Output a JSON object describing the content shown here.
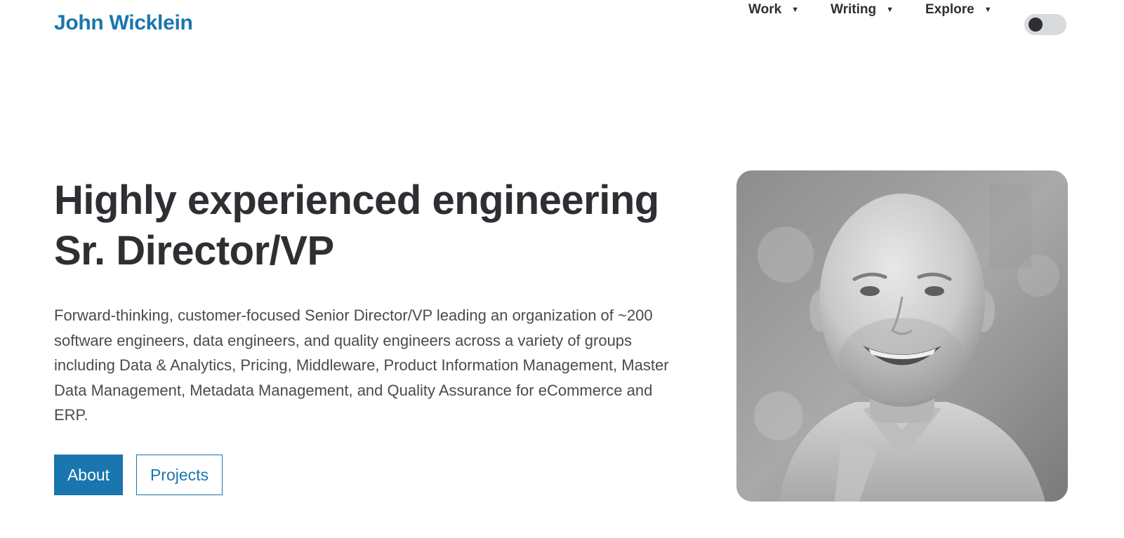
{
  "header": {
    "site_title": "John Wicklein",
    "nav": [
      {
        "label": "Work",
        "icon": "caret-down-icon"
      },
      {
        "label": "Writing",
        "icon": "caret-down-icon"
      },
      {
        "label": "Explore",
        "icon": "caret-down-icon"
      }
    ],
    "theme_toggle": {
      "icon": "theme-toggle",
      "state": "off"
    }
  },
  "hero": {
    "title_line1": "Highly experienced engineering",
    "title_line2": "Sr. Director/VP",
    "description": "Forward-thinking, customer-focused Senior Director/VP leading an organization of ~200 software engineers, data engineers, and quality engineers across a variety of groups including Data & Analytics, Pricing, Middleware, Product Information Management, Master Data Management, Metadata Management, and Quality Assurance for eCommerce and ERP.",
    "primary_button": "About",
    "secondary_button": "Projects",
    "portrait": {
      "icon": "portrait-photo"
    }
  },
  "colors": {
    "accent": "#1a76ae",
    "text": "#2e2f33",
    "body_text": "#4a4b50",
    "toggle_bg": "#d9dadc"
  }
}
